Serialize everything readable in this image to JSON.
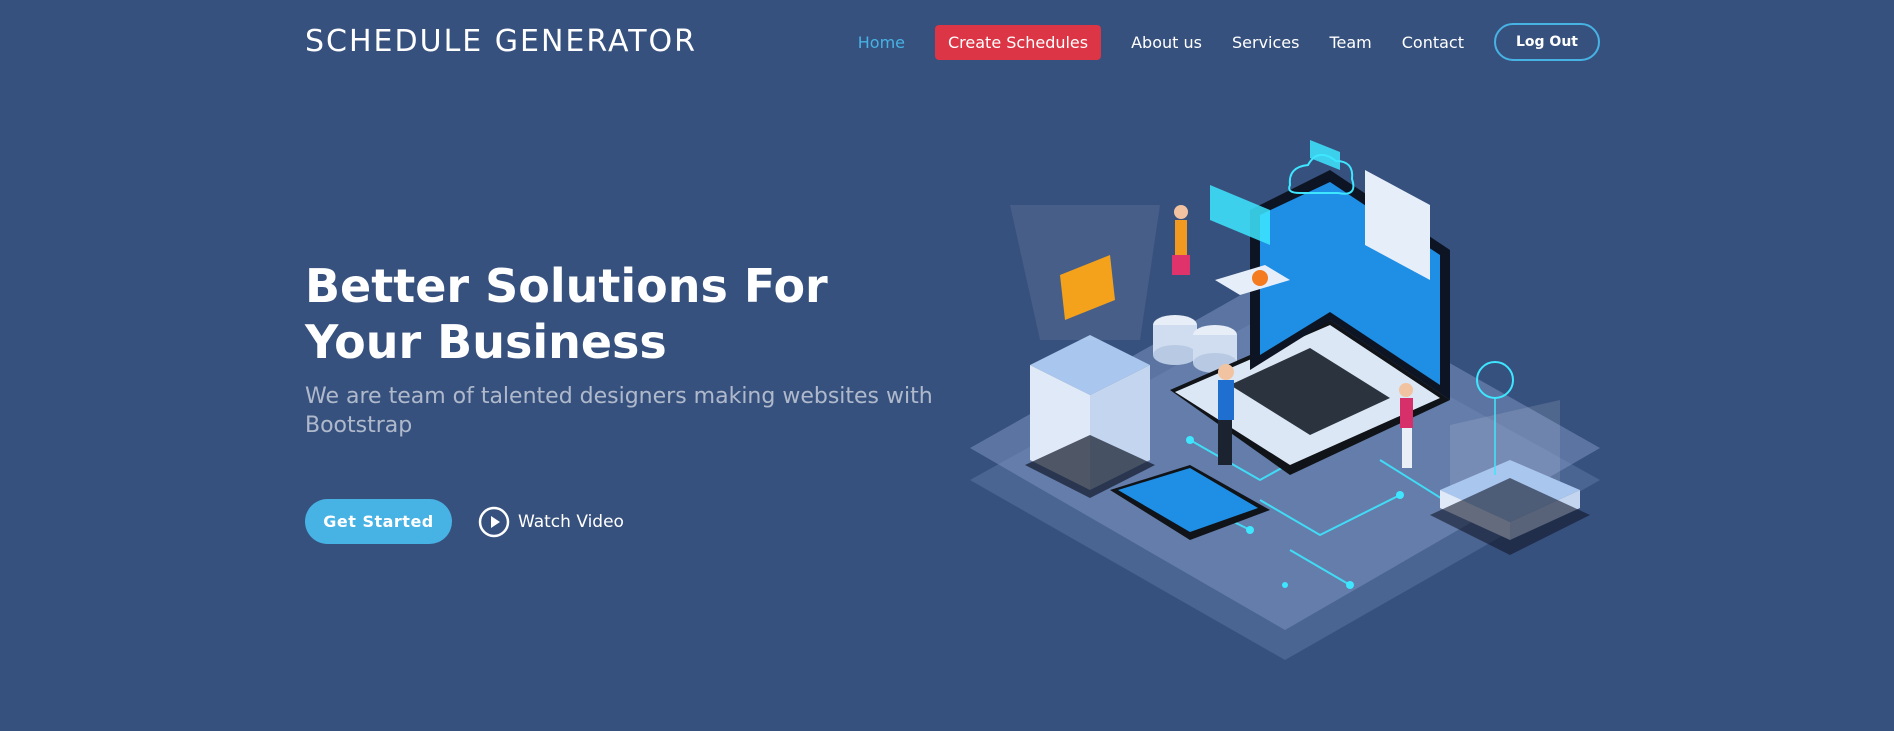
{
  "header": {
    "logo": "SCHEDULE GENERATOR",
    "nav": {
      "home": "Home",
      "create": "Create Schedules",
      "about": "About us",
      "services": "Services",
      "team": "Team",
      "contact": "Contact",
      "logout": "Log Out"
    }
  },
  "hero": {
    "title": "Better Solutions For Your Business",
    "subtitle": "We are team of talented designers making websites with Bootstrap",
    "get_started": "Get Started",
    "watch_video": "Watch Video",
    "illustration_icon": "isometric-tech-illustration"
  },
  "colors": {
    "background": "#37517e",
    "accent": "#47b2e4",
    "cta_red": "#dc3545"
  }
}
